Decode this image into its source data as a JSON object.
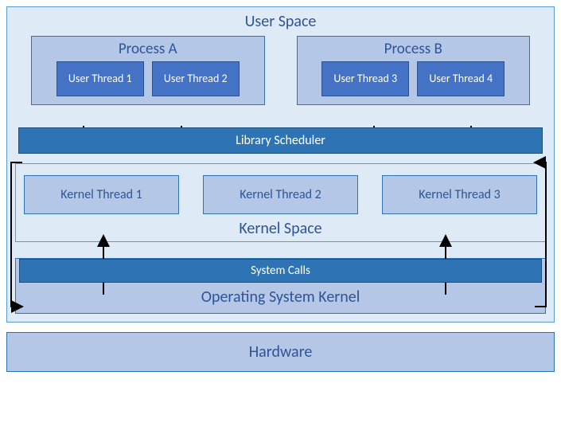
{
  "user_space": {
    "title": "User Space",
    "processes": [
      {
        "title": "Process A",
        "threads": [
          "User Thread 1",
          "User Thread 2"
        ]
      },
      {
        "title": "Process B",
        "threads": [
          "User Thread 3",
          "User Thread 4"
        ]
      }
    ],
    "library_scheduler": "Library Scheduler"
  },
  "kernel_space": {
    "title": "Kernel Space",
    "threads": [
      "Kernel Thread 1",
      "Kernel Thread 2",
      "Kernel Thread 3"
    ],
    "system_calls": "System Calls",
    "os_kernel": "Operating System Kernel"
  },
  "hardware": "Hardware"
}
